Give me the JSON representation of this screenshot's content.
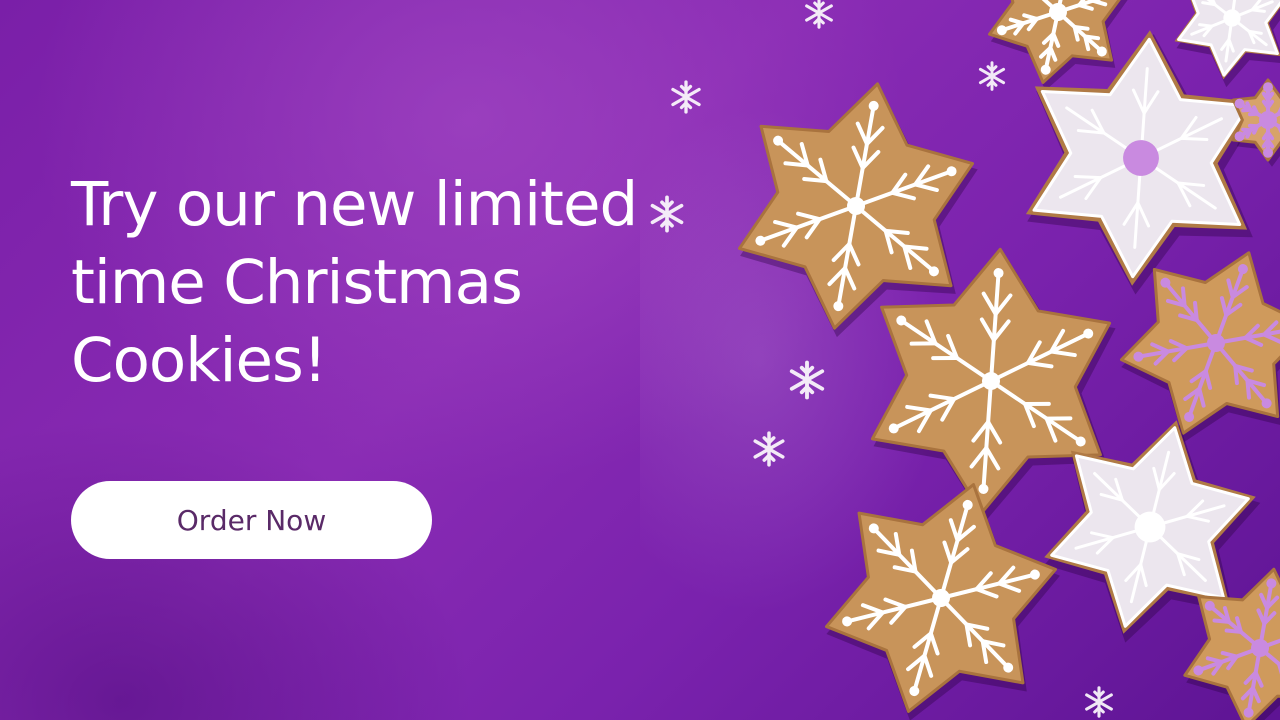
{
  "banner": {
    "headline": "Try our new limited time Christmas Cookies!",
    "cta_label": "Order Now"
  },
  "decor": {
    "cookie_icon": "snowflake-cookie-icon",
    "star_cookie_icon": "star-cookie-icon",
    "snowflake_icon": "snowflake-icon"
  },
  "colors": {
    "background": "#7a1fa8",
    "button_bg": "#ffffff",
    "button_text": "#5a2a68",
    "cookie_dough": "#c8945a",
    "icing_white": "#ffffff",
    "icing_lilac": "#c98ae0"
  }
}
